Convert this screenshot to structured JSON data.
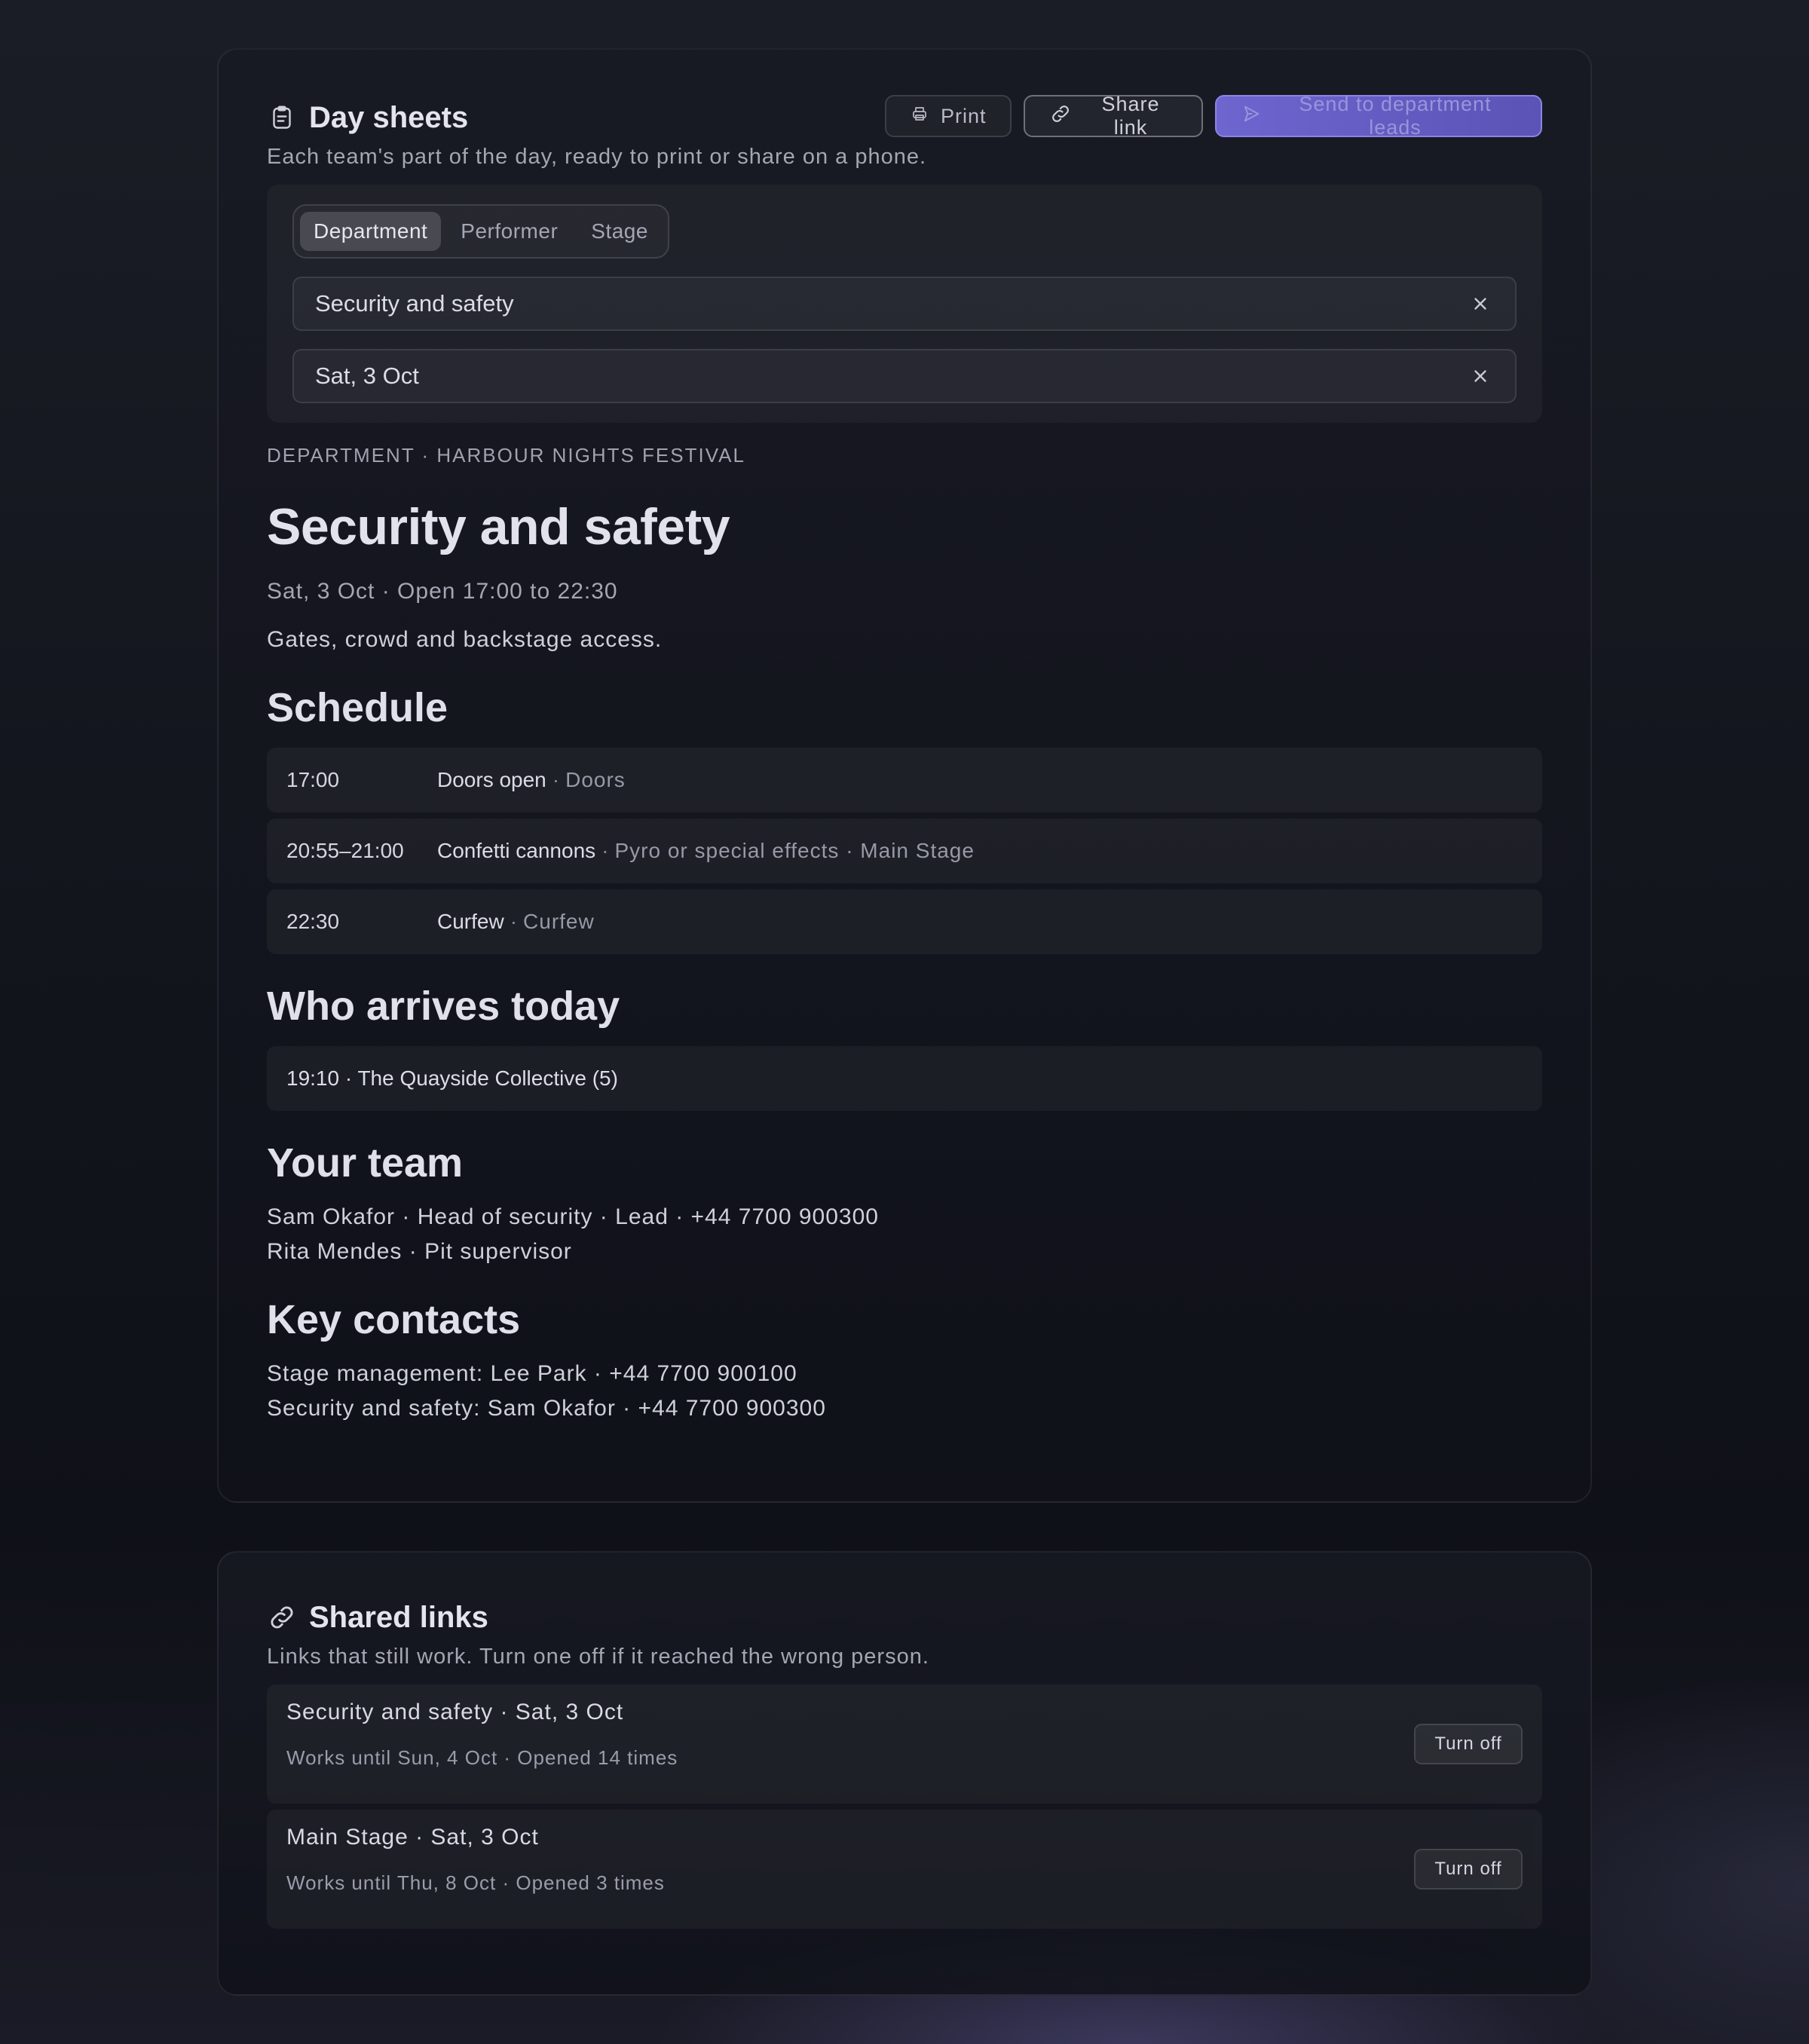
{
  "day_sheets": {
    "title": "Day sheets",
    "subtitle": "Each team's part of the day, ready to print or share on a phone.",
    "actions": {
      "print": "Print",
      "share": "Share link",
      "send": "Send to department leads"
    },
    "segments": [
      "Department",
      "Performer",
      "Stage"
    ],
    "active_segment": "Department",
    "filters": {
      "department": "Security and safety",
      "date": "Sat, 3 Oct"
    },
    "eyebrow": "DEPARTMENT · HARBOUR NIGHTS FESTIVAL",
    "sheet_title": "Security and safety",
    "sheet_meta": "Sat, 3 Oct · Open 17:00 to 22:30",
    "sheet_desc": "Gates, crowd and backstage access.",
    "schedule_heading": "Schedule",
    "schedule": [
      {
        "time": "17:00",
        "title": "Doors open",
        "sub": "Doors"
      },
      {
        "time": "20:55–21:00",
        "title": "Confetti cannons",
        "sub": "Pyro or special effects · Main Stage"
      },
      {
        "time": "22:30",
        "title": "Curfew",
        "sub": "Curfew"
      }
    ],
    "arrivals_heading": "Who arrives today",
    "arrivals": [
      "19:10 · The Quayside Collective (5)"
    ],
    "team_heading": "Your team",
    "team": [
      "Sam Okafor · Head of security · Lead · +44 7700 900300",
      "Rita Mendes · Pit supervisor"
    ],
    "contacts_heading": "Key contacts",
    "contacts": [
      "Stage management: Lee Park · +44 7700 900100",
      "Security and safety: Sam Okafor · +44 7700 900300"
    ]
  },
  "shared_links": {
    "title": "Shared links",
    "subtitle": "Links that still work. Turn one off if it reached the wrong person.",
    "items": [
      {
        "title": "Security and safety · Sat, 3 Oct",
        "sub": "Works until Sun, 4 Oct · Opened 14 times",
        "action": "Turn off"
      },
      {
        "title": "Main Stage · Sat, 3 Oct",
        "sub": "Works until Thu, 8 Oct · Opened 3 times",
        "action": "Turn off"
      }
    ]
  },
  "icons": {
    "day_sheets": "clipboard-icon",
    "shared_links": "link-icon",
    "print": "printer-icon",
    "share": "link-icon",
    "send": "send-icon",
    "clear": "close-icon"
  },
  "colors": {
    "accent": "#6e66cf",
    "background": "#13151d"
  }
}
